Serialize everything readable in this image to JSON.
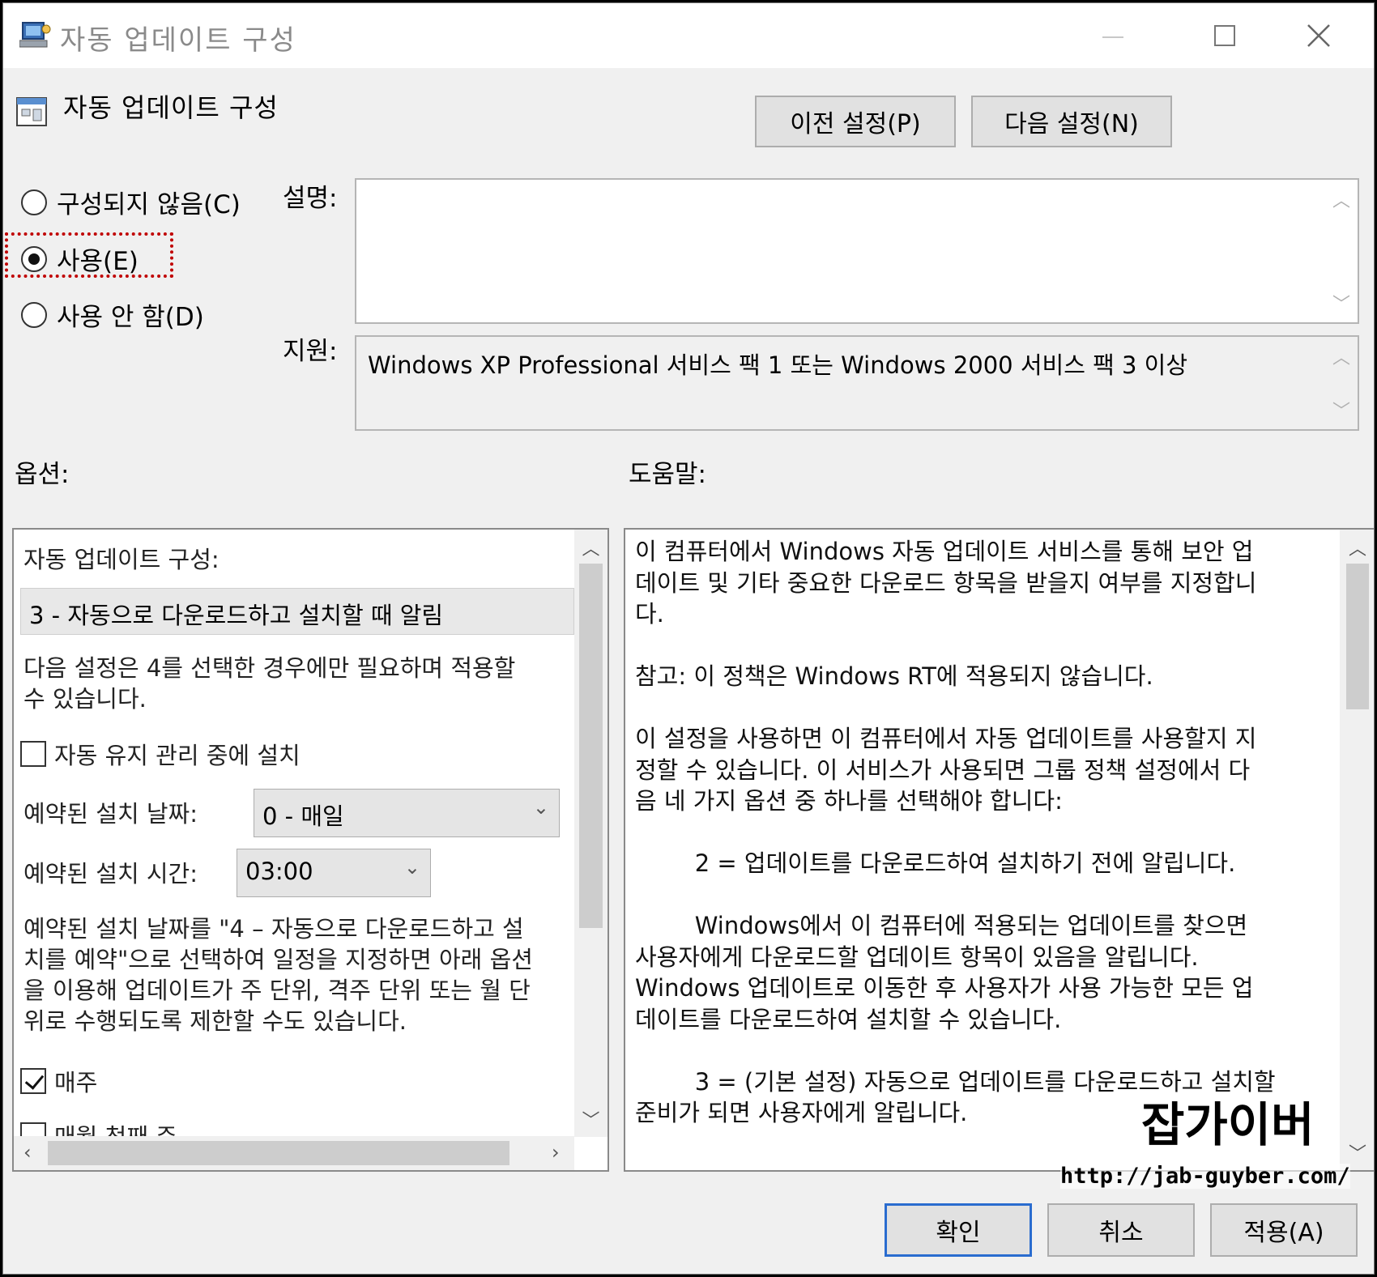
{
  "window": {
    "title": "자동 업데이트 구성",
    "controls": {
      "minimize": "—",
      "maximize": "☐",
      "close": "✕"
    }
  },
  "policy": {
    "title": "자동 업데이트 구성",
    "prev_button": "이전 설정(P)",
    "next_button": "다음 설정(N)"
  },
  "state": {
    "options": [
      {
        "label": "구성되지 않음(C)",
        "selected": false
      },
      {
        "label": "사용(E)",
        "selected": true
      },
      {
        "label": "사용 안 함(D)",
        "selected": false
      }
    ]
  },
  "comment": {
    "label": "설명:",
    "value": ""
  },
  "supported": {
    "label": "지원:",
    "value": "Windows XP Professional 서비스 팩 1 또는 Windows 2000 서비스 팩 3 이상"
  },
  "options_section": {
    "label": "옵션:",
    "configure_label": "자동 업데이트 구성:",
    "configure_value": "3 - 자동으로 다운로드하고 설치할 때 알림",
    "note_lines": [
      "다음 설정은 4를 선택한 경우에만 필요하며 적용할",
      "수 있습니다."
    ],
    "maintenance_checkbox": {
      "label": "자동 유지 관리 중에 설치",
      "checked": false
    },
    "install_day": {
      "label": "예약된 설치 날짜:",
      "value": "0 - 매일"
    },
    "install_time": {
      "label": "예약된 설치 시간:",
      "value": "03:00"
    },
    "schedule_lines": [
      "예약된 설치 날짜를 \"4 – 자동으로 다운로드하고 설",
      "치를 예약\"으로 선택하여 일정을 지정하면 아래 옵션",
      "을 이용해 업데이트가 주 단위, 격주 단위 또는 월 단",
      "위로 수행되도록 제한할 수도 있습니다."
    ],
    "weekly_checkbox": {
      "label": "매주",
      "checked": true
    },
    "first_week_checkbox": {
      "label": "매월 첫째 주",
      "checked": false
    }
  },
  "help_section": {
    "label": "도움말:",
    "lines": [
      "이 컴퓨터에서 Windows 자동 업데이트 서비스를 통해 보안 업",
      "데이트 및 기타 중요한 다운로드 항목을 받을지 여부를 지정합니",
      "다.",
      "",
      "참고: 이 정책은 Windows RT에 적용되지 않습니다.",
      "",
      "이 설정을 사용하면 이 컴퓨터에서 자동 업데이트를 사용할지 지",
      "정할 수 있습니다. 이 서비스가 사용되면 그룹 정책 설정에서 다",
      "음 네 가지 옵션 중 하나를 선택해야 합니다:",
      "",
      "        2 = 업데이트를 다운로드하여 설치하기 전에 알립니다.",
      "",
      "        Windows에서 이 컴퓨터에 적용되는 업데이트를 찾으면",
      "사용자에게 다운로드할 업데이트 항목이 있음을 알립니다.",
      "Windows 업데이트로 이동한 후 사용자가 사용 가능한 모든 업",
      "데이트를 다운로드하여 설치할 수 있습니다.",
      "",
      "        3 = (기본 설정) 자동으로 업데이트를 다운로드하고 설치할",
      "준비가 되면 사용자에게 알립니다."
    ]
  },
  "footer": {
    "ok": "확인",
    "cancel": "취소",
    "apply": "적용(A)"
  },
  "watermark": {
    "name": "잡가이버",
    "url": "http://jab-guyber.com/"
  },
  "colors": {
    "focus_dotted": "#c00000",
    "ok_border": "#2a6ccf",
    "window_bg": "#f0f0f0"
  }
}
